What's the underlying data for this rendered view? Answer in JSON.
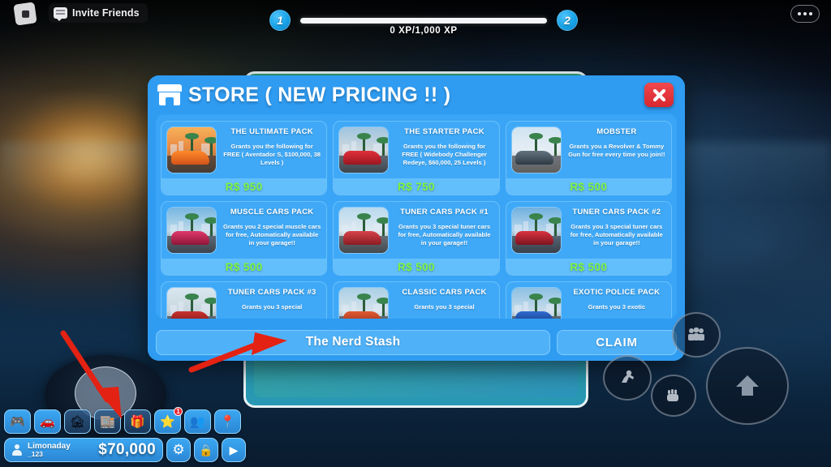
{
  "topbar": {
    "roblox_logo_name": "roblox-logo",
    "invite_label": "Invite Friends",
    "menu_label": "•••"
  },
  "xp": {
    "current_level": "1",
    "next_level": "2",
    "progress_text": "0 XP/1,000 XP",
    "progress_percent": 0
  },
  "store": {
    "title": "STORE ( NEW PRICING !! )",
    "close_label": "✕",
    "items": [
      {
        "name": "THE ULTIMATE  PACK",
        "desc": "Grants you the following for FREE ( Aventador S, $100,000, 38 Levels )",
        "price": "R$ 950"
      },
      {
        "name": "THE STARTER PACK",
        "desc": "Grants you the following for FREE ( Widebody Challenger Redeye, $60,000, 25 Levels )",
        "price": "R$ 750"
      },
      {
        "name": "MOBSTER",
        "desc": "Grants you a Revolver & Tommy Gun for free every time you join!!",
        "price": "R$ 500"
      },
      {
        "name": "MUSCLE CARS PACK",
        "desc": "Grants you 2 special muscle cars for free, Automatically available in your garage!!",
        "price": "R$ 500"
      },
      {
        "name": "TUNER CARS PACK #1",
        "desc": "Grants you 3 special tuner cars for free, Automatically available in your garage!!",
        "price": "R$ 500"
      },
      {
        "name": "TUNER CARS PACK #2",
        "desc": "Grants you 3 special tuner cars for free, Automatically available in your garage!!",
        "price": "R$ 500"
      },
      {
        "name": "TUNER CARS PACK #3",
        "desc": "Grants you 3 special",
        "price": ""
      },
      {
        "name": "CLASSIC CARS PACK",
        "desc": "Grants you 3 special",
        "price": ""
      },
      {
        "name": "EXOTIC POLICE PACK",
        "desc": "Grants you 3 exotic",
        "price": ""
      }
    ],
    "code_value": "The Nerd Stash",
    "code_placeholder": "The Nerd Stash",
    "claim_label": "CLAIM"
  },
  "hud": {
    "icons": [
      {
        "name": "controller-icon",
        "glyph": "🎮",
        "badge": ""
      },
      {
        "name": "car-icon",
        "glyph": "🚗",
        "badge": ""
      },
      {
        "name": "garage-icon",
        "glyph": "🏚",
        "badge": ""
      },
      {
        "name": "store-icon",
        "glyph": "🏬",
        "badge": ""
      },
      {
        "name": "gift-icon",
        "glyph": "🎁",
        "badge": ""
      },
      {
        "name": "star-icon",
        "glyph": "⭐",
        "badge": "1"
      },
      {
        "name": "friends-icon",
        "glyph": "👥",
        "badge": ""
      },
      {
        "name": "map-pin-icon",
        "glyph": "📍",
        "badge": ""
      }
    ],
    "player_name": "Limonaday",
    "player_name_suffix": "_123",
    "money": "$70,000",
    "settings_glyph": "⚙",
    "lock_glyph": "🔒",
    "video_glyph": "▶"
  },
  "colors": {
    "dialog_blue": "#2f9cf2",
    "card_blue": "#3fa9f7",
    "price_green": "#7ff53f",
    "close_red": "#d8262f",
    "accent_cyan": "#18a3e8",
    "annotation_red": "#e32213"
  }
}
